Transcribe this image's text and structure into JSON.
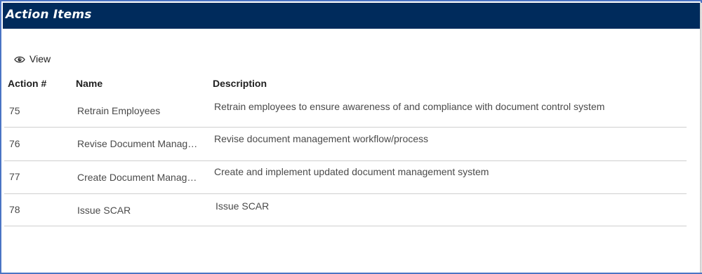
{
  "header": {
    "title": "Action Items"
  },
  "toolbar": {
    "view_label": "View",
    "view_icon": "eye-icon"
  },
  "table": {
    "columns": [
      "Action #",
      "Name",
      "Description"
    ],
    "rows": [
      {
        "action_no": "75",
        "name": "Retrain Employees",
        "description": "Retrain employees to ensure awareness of and compliance with document control system"
      },
      {
        "action_no": "76",
        "name": "Revise Document Manage…",
        "description": "Revise document management workflow/process"
      },
      {
        "action_no": "77",
        "name": "Create Document Manage…",
        "description": "Create and implement updated document management system"
      },
      {
        "action_no": "78",
        "name": "Issue SCAR",
        "description": "Issue SCAR"
      }
    ]
  },
  "colors": {
    "header_bg": "#002b5c",
    "frame_border": "#4a74c4",
    "row_divider": "#cfcfcf"
  }
}
